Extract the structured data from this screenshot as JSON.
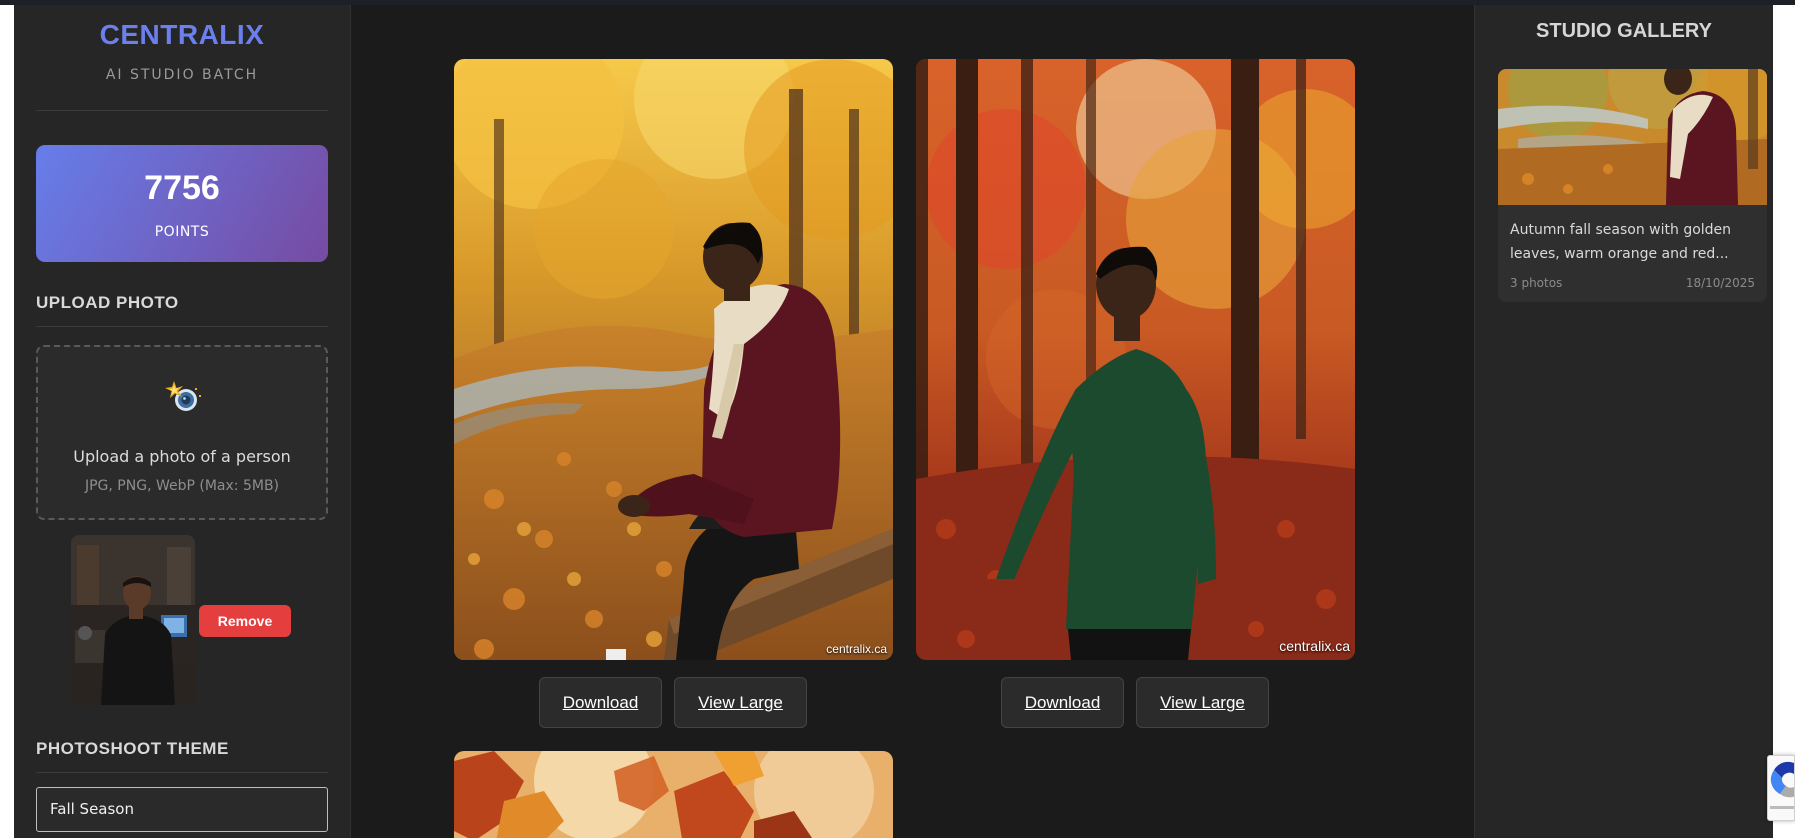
{
  "sidebar": {
    "brand": "CENTRALIX",
    "subtitle": "AI STUDIO BATCH",
    "points": {
      "value": "7756",
      "label": "POINTS"
    },
    "upload": {
      "section_title": "UPLOAD PHOTO",
      "prompt": "Upload a photo of a person",
      "hint": "JPG, PNG, WebP (Max: 5MB)",
      "remove_label": "Remove"
    },
    "theme": {
      "section_title": "PHOTOSHOOT THEME",
      "value": "Fall Season"
    }
  },
  "main": {
    "photos": [
      {
        "watermark": "centralix.ca",
        "download_label": "Download",
        "view_label": "View Large"
      },
      {
        "watermark": "centralix.ca",
        "download_label": "Download",
        "view_label": "View Large"
      }
    ]
  },
  "gallery": {
    "title": "STUDIO GALLERY",
    "items": [
      {
        "description": "Autumn fall season with golden leaves, warm orange and red...",
        "count": "3 photos",
        "date": "18/10/2025"
      }
    ]
  },
  "colors": {
    "brand": "#6b80ee",
    "points_gradient_start": "#667eea",
    "points_gradient_end": "#764ba2",
    "remove": "#e53e3e"
  }
}
